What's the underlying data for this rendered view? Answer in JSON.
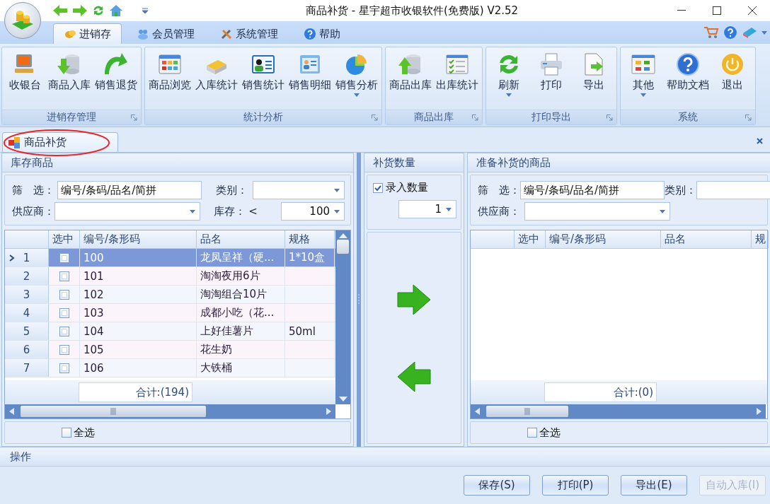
{
  "window": {
    "title": "商品补货 - 星宇超市收银软件(免费版) V2.52"
  },
  "ribbon_tabs": [
    {
      "label": "进销存",
      "selected": true
    },
    {
      "label": "会员管理",
      "selected": false
    },
    {
      "label": "系统管理",
      "selected": false
    },
    {
      "label": "帮助",
      "selected": false
    }
  ],
  "ribbon_groups": [
    {
      "title": "进销存管理",
      "buttons": [
        {
          "label": "收银台",
          "dropdown": false
        },
        {
          "label": "商品入库",
          "dropdown": false
        },
        {
          "label": "销售退货",
          "dropdown": false
        }
      ]
    },
    {
      "title": "统计分析",
      "buttons": [
        {
          "label": "商品浏览",
          "dropdown": false
        },
        {
          "label": "入库统计",
          "dropdown": false
        },
        {
          "label": "销售统计",
          "dropdown": false
        },
        {
          "label": "销售明细",
          "dropdown": false
        },
        {
          "label": "销售分析",
          "dropdown": true
        }
      ]
    },
    {
      "title": "商品出库",
      "buttons": [
        {
          "label": "商品出库",
          "dropdown": false
        },
        {
          "label": "出库统计",
          "dropdown": false
        }
      ]
    },
    {
      "title": "打印导出",
      "buttons": [
        {
          "label": "刷新",
          "dropdown": true
        },
        {
          "label": "打印",
          "dropdown": false
        },
        {
          "label": "导出",
          "dropdown": false
        }
      ]
    },
    {
      "title": "系统",
      "buttons": [
        {
          "label": "其他",
          "dropdown": true
        },
        {
          "label": "帮助文档",
          "dropdown": false
        },
        {
          "label": "退出",
          "dropdown": false
        }
      ]
    }
  ],
  "document_tabs": [
    {
      "label": "商品补货",
      "selected": true
    }
  ],
  "stock_panel": {
    "title": "库存商品",
    "filter_label": "筛　选：",
    "filter_value": "编号/条码/品名/简拼",
    "category_label": "类别：",
    "supplier_label": "供应商：",
    "stock_label": "库存：",
    "stock_operator": "<",
    "stock_value": "100",
    "columns": [
      "选中",
      "编号/条形码",
      "品名",
      "规格"
    ],
    "rows": [
      {
        "number": "1",
        "selected": true,
        "checked": false,
        "code": "100",
        "name": "龙凤呈祥（硬...",
        "spec": "1*10盒"
      },
      {
        "number": "2",
        "selected": false,
        "checked": false,
        "code": "101",
        "name": "淘淘夜用6片"
      },
      {
        "number": "3",
        "selected": false,
        "checked": false,
        "code": "102",
        "name": "淘淘组合10片"
      },
      {
        "number": "4",
        "selected": false,
        "checked": false,
        "code": "103",
        "name": "成都小吃（花..."
      },
      {
        "number": "5",
        "selected": false,
        "checked": false,
        "code": "104",
        "name": "上好佳薯片",
        "spec": "50ml"
      },
      {
        "number": "6",
        "selected": false,
        "checked": false,
        "code": "105",
        "name": "花生奶"
      },
      {
        "number": "7",
        "selected": false,
        "checked": false,
        "code": "106",
        "name": "大铁桶"
      }
    ],
    "total": "合计:(194)",
    "select_all": {
      "label": "全选",
      "checked": false
    }
  },
  "quantity_panel": {
    "title": "补货数量",
    "enter_quantity": {
      "label": "录入数量",
      "checked": true
    },
    "quantity": "1"
  },
  "restock_panel": {
    "title": "准备补货的商品",
    "filter_label": "筛　选：",
    "filter_value": "编号/条码/品名/简拼",
    "category_label": "类别：",
    "supplier_label": "供应商：",
    "columns": [
      "选中",
      "编号/条形码",
      "品名",
      "规"
    ],
    "total": "合计:(0)",
    "select_all": {
      "label": "全选",
      "checked": false
    }
  },
  "operations": {
    "title": "操作",
    "buttons": [
      {
        "label": "保存(S)",
        "disabled": false
      },
      {
        "label": "打印(P)",
        "disabled": false
      },
      {
        "label": "导出(E)",
        "disabled": false
      },
      {
        "label": "自动入库(I)",
        "disabled": true
      }
    ]
  }
}
